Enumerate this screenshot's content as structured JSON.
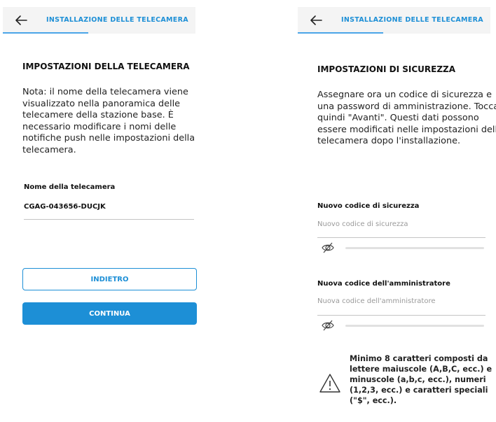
{
  "screen1": {
    "header_title": "INSTALLAZIONE DELLE TELECAMERA",
    "section_title": "IMPOSTAZIONI DELLA TELECAMERA",
    "description": "Nota: il nome della telecamera viene visualizzato nella panoramica delle telecamere della stazione base. È necessario modificare i nomi delle notifiche push nelle impostazioni della telecamera.",
    "name_label": "Nome della telecamera",
    "name_value": "CGAG-043656-DUCJK",
    "back_button": "INDIETRO",
    "continue_button": "CONTINUA"
  },
  "screen2": {
    "header_title": "INSTALLAZIONE DELLE TELECAMERA",
    "section_title": "IMPOSTAZIONI DI SICUREZZA",
    "description": "Assegnare ora un codice di sicurezza e una password di amministrazione. Toccare quindi \"Avanti\". Questi dati possono essere modificati nelle impostazioni della telecamera dopo l'installazione.",
    "security_label": "Nuovo codice di sicurezza",
    "security_placeholder": "Nuovo codice di sicurezza",
    "admin_label": "Nuova codice dell'amministratore",
    "admin_placeholder": "Nuova codice dell'amministratore",
    "requirements_note": "Minimo 8 caratteri composti da lettere maiuscole (A,B,C, ecc.) e minuscole (a,b,c, ecc.), numeri (1,2,3, ecc.) e caratteri speciali (\"$\", ecc.)."
  },
  "icons": [
    "back-arrow-icon",
    "eye-hidden-icon",
    "warning-triangle-icon"
  ],
  "colors": {
    "accent": "#1d8fd6",
    "header_bg": "#f4f4f4",
    "divider": "#c4c4c4",
    "placeholder": "#9a9a9a"
  }
}
